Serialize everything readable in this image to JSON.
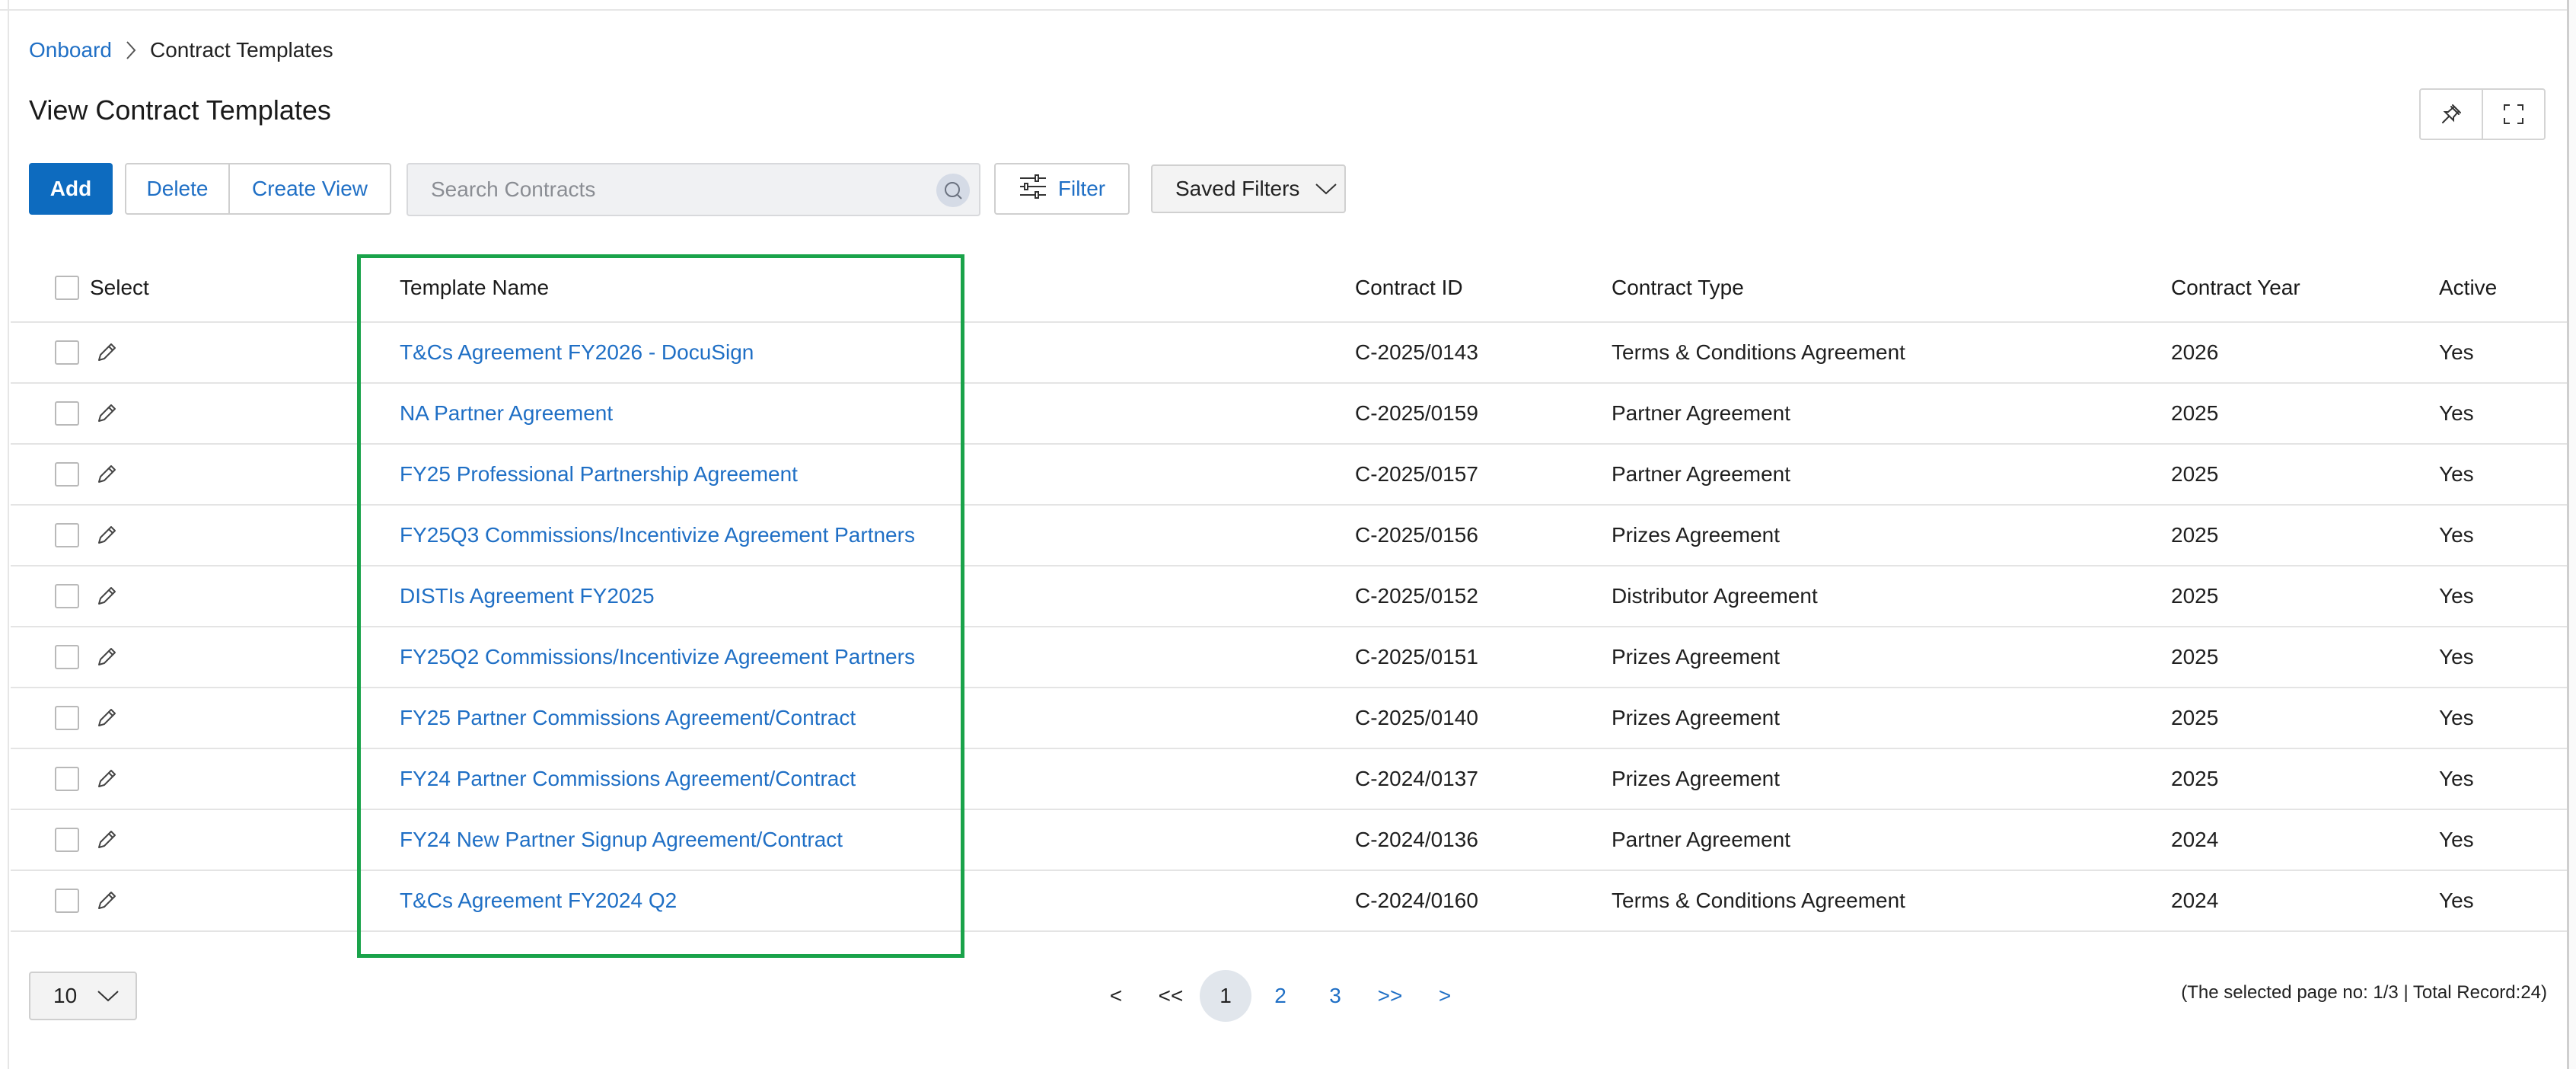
{
  "breadcrumb": {
    "root": "Onboard",
    "current": "Contract Templates"
  },
  "page_title": "View Contract Templates",
  "toolbar": {
    "add_label": "Add",
    "delete_label": "Delete",
    "create_view_label": "Create View",
    "search_placeholder": "Search Contracts",
    "filter_label": "Filter",
    "saved_filters_label": "Saved Filters"
  },
  "table": {
    "columns": {
      "select": "Select",
      "name": "Template Name",
      "id": "Contract ID",
      "type": "Contract Type",
      "year": "Contract Year",
      "active": "Active"
    },
    "rows": [
      {
        "name": "T&Cs Agreement FY2026 - DocuSign",
        "id": "C-2025/0143",
        "type": "Terms & Conditions Agreement",
        "year": "2026",
        "active": "Yes"
      },
      {
        "name": "NA Partner Agreement",
        "id": "C-2025/0159",
        "type": "Partner Agreement",
        "year": "2025",
        "active": "Yes"
      },
      {
        "name": "FY25 Professional Partnership Agreement",
        "id": "C-2025/0157",
        "type": "Partner Agreement",
        "year": "2025",
        "active": "Yes"
      },
      {
        "name": "FY25Q3 Commissions/Incentivize Agreement Partners",
        "id": "C-2025/0156",
        "type": "Prizes Agreement",
        "year": "2025",
        "active": "Yes"
      },
      {
        "name": "DISTIs Agreement FY2025",
        "id": "C-2025/0152",
        "type": "Distributor Agreement",
        "year": "2025",
        "active": "Yes"
      },
      {
        "name": "FY25Q2 Commissions/Incentivize Agreement Partners",
        "id": "C-2025/0151",
        "type": "Prizes Agreement",
        "year": "2025",
        "active": "Yes"
      },
      {
        "name": "FY25 Partner Commissions Agreement/Contract",
        "id": "C-2025/0140",
        "type": "Prizes Agreement",
        "year": "2025",
        "active": "Yes"
      },
      {
        "name": "FY24 Partner Commissions Agreement/Contract",
        "id": "C-2024/0137",
        "type": "Prizes Agreement",
        "year": "2025",
        "active": "Yes"
      },
      {
        "name": "FY24 New Partner Signup Agreement/Contract",
        "id": "C-2024/0136",
        "type": "Partner Agreement",
        "year": "2024",
        "active": "Yes"
      },
      {
        "name": "T&Cs Agreement FY2024 Q2",
        "id": "C-2024/0160",
        "type": "Terms & Conditions Agreement",
        "year": "2024",
        "active": "Yes"
      }
    ]
  },
  "pagination": {
    "page_size": "10",
    "prev": "<",
    "first": "<<",
    "pages": [
      "1",
      "2",
      "3"
    ],
    "last": ">>",
    "next": ">",
    "info": "(The selected page no: 1/3 | Total Record:24)"
  },
  "colors": {
    "accent": "#0d6bbf",
    "link": "#1f6fc5",
    "highlight": "#1aa34a"
  },
  "icons": {
    "breadcrumb_separator": "chevron-right-icon",
    "pin": "pin-icon",
    "fullscreen": "expand-icon",
    "search": "search-icon",
    "filter": "sliders-icon",
    "dropdown": "chevron-down-icon",
    "edit": "pencil-icon"
  }
}
